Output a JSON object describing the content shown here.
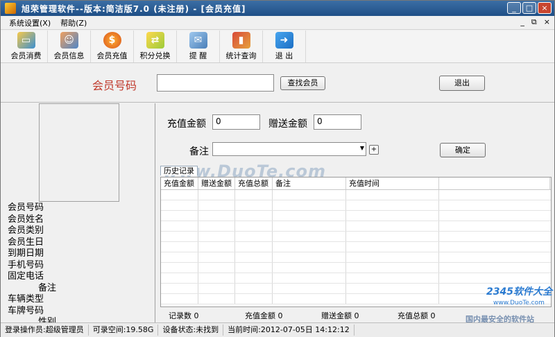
{
  "window": {
    "title": "旭荣管理软件--版本:简洁版7.0 (未注册) - [会员充值]",
    "controls": [
      "_",
      "□",
      "×"
    ]
  },
  "menu": {
    "items": [
      "系统设置(X)",
      "帮助(Z)"
    ],
    "mdi_controls": [
      "_",
      "⧉",
      "×"
    ]
  },
  "toolbar": {
    "buttons": [
      {
        "label": "会员消费",
        "icon": "card-icon"
      },
      {
        "label": "会员信息",
        "icon": "users-icon"
      },
      {
        "label": "会员充值",
        "icon": "coin-icon"
      },
      {
        "label": "积分兑换",
        "icon": "exchange-icon"
      },
      {
        "label": "提 醒",
        "icon": "reminder-icon"
      },
      {
        "label": "统计查询",
        "icon": "stats-icon"
      },
      {
        "label": "退 出",
        "icon": "exit-icon"
      }
    ]
  },
  "search": {
    "member_no_label": "会员号码",
    "member_no_value": "",
    "find_button": "查找会员",
    "exit_button": "退出"
  },
  "member_info": {
    "fields": [
      "会员号码",
      "会员姓名",
      "会员类别",
      "会员生日",
      "到期日期",
      "手机号码",
      "固定电话",
      "备注",
      "车辆类型",
      "车牌号码",
      "性别"
    ]
  },
  "recharge": {
    "amount_label": "充值金额",
    "amount_value": "0",
    "bonus_label": "赠送金额",
    "bonus_value": "0",
    "remark_label": "备注",
    "remark_value": "",
    "plus_button": "+",
    "confirm_button": "确定"
  },
  "history": {
    "tab_label": "历史记录",
    "columns": [
      "充值金额",
      "赠送金额",
      "充值总额",
      "备注",
      "充值时间",
      ""
    ],
    "rows": [],
    "summary": {
      "record_count": "记录数 0",
      "recharge_amount": "充值金额 0",
      "bonus_amount": "赠送金额 0",
      "recharge_total": "充值总额 0"
    }
  },
  "watermark": "www.DuoTe.com",
  "status": {
    "operator": "登录操作员:超级管理员",
    "space": "可录空间:19.58G",
    "device": "设备状态:未找到",
    "time": "当前时间:2012-07-05日 14:12:12"
  },
  "brand": {
    "name": "2345软件大全",
    "url": "www.DuoTe.com",
    "slogan": "国内最安全的软件站"
  }
}
